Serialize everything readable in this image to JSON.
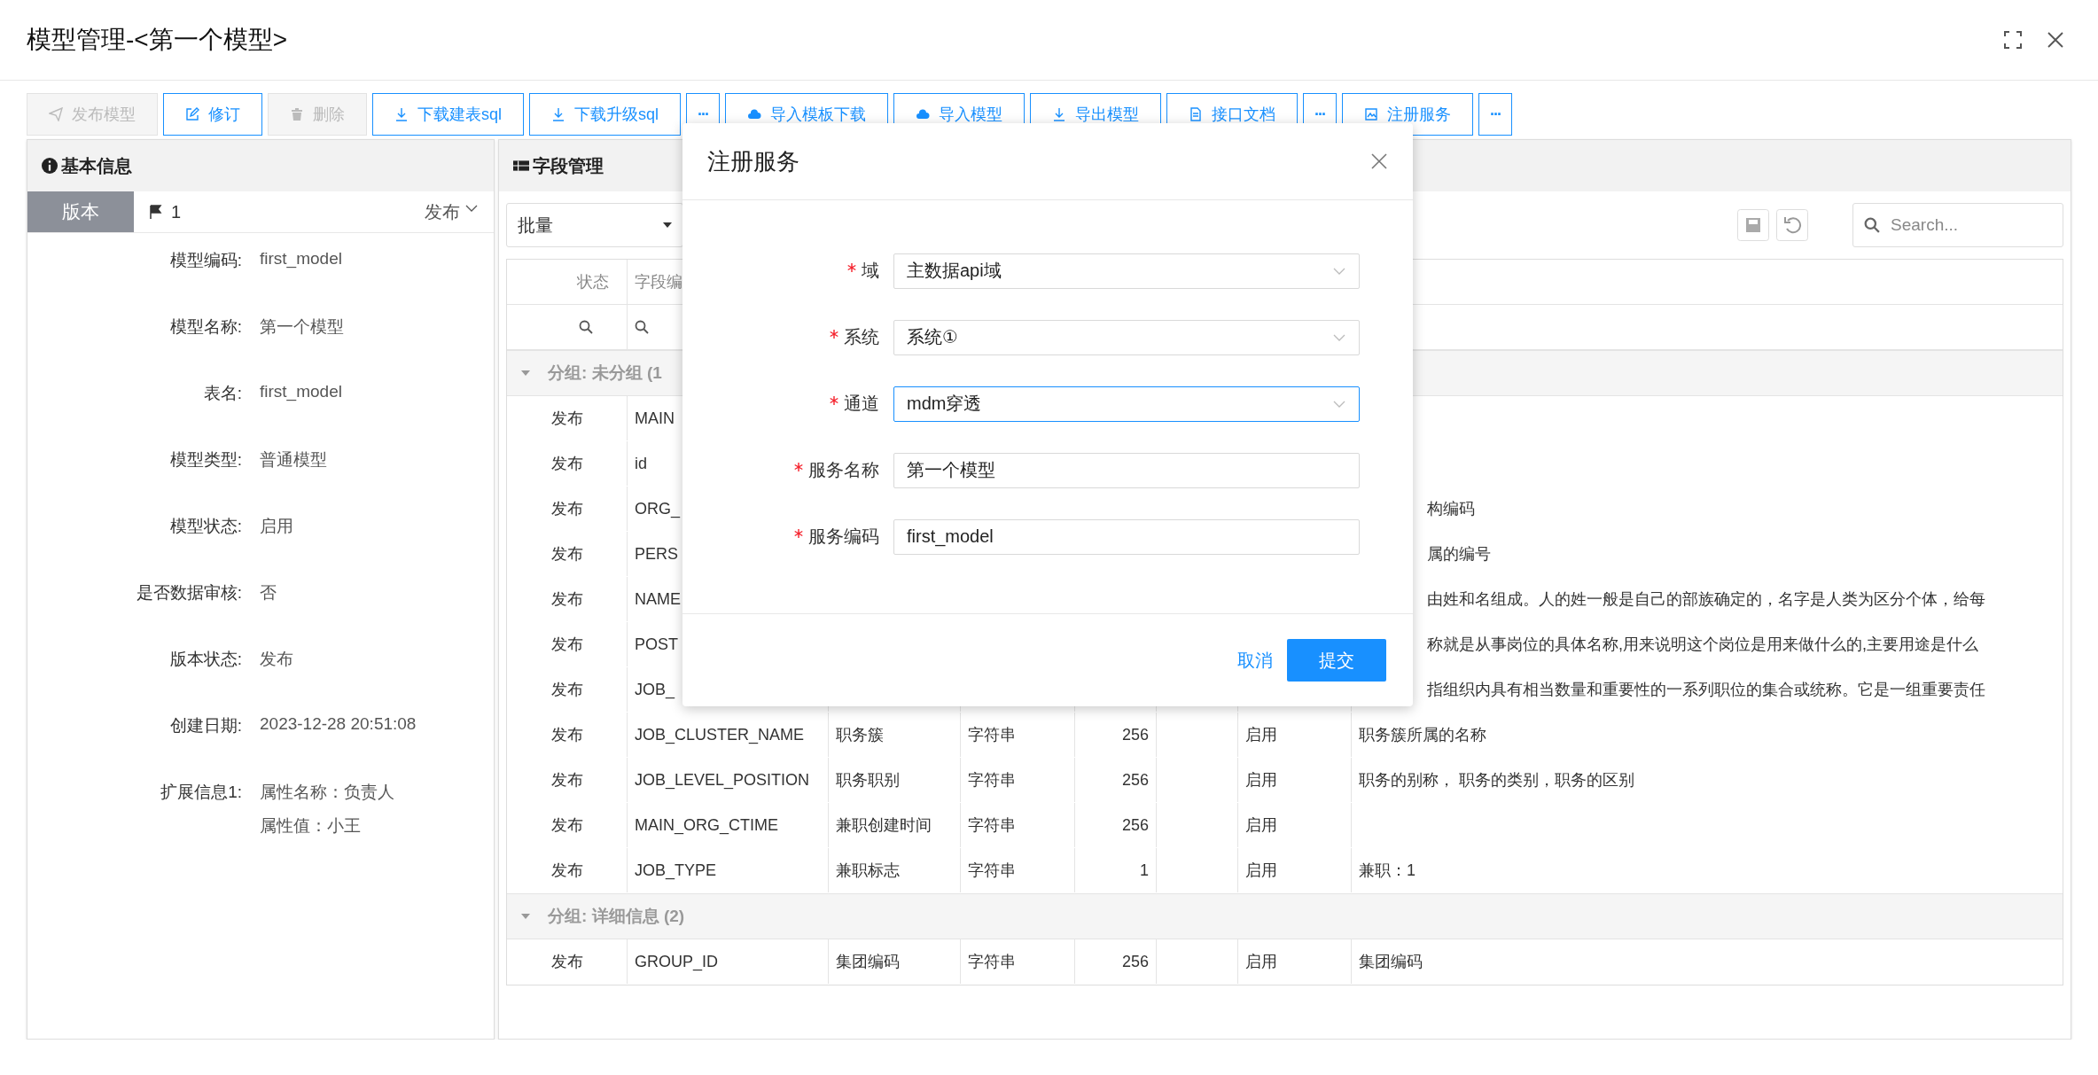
{
  "window": {
    "title": "模型管理-<第一个模型>"
  },
  "toolbar": [
    {
      "label": "发布模型",
      "kind": "send",
      "disabled": true
    },
    {
      "label": "修订",
      "kind": "edit",
      "disabled": false
    },
    {
      "label": "删除",
      "kind": "trash",
      "disabled": true
    },
    {
      "label": "下载建表sql",
      "kind": "download",
      "disabled": false
    },
    {
      "label": "下载升级sql",
      "kind": "download",
      "disabled": false
    },
    {
      "label": "···",
      "kind": "more",
      "disabled": false
    },
    {
      "label": "导入模板下载",
      "kind": "upload",
      "disabled": false
    },
    {
      "label": "导入模型",
      "kind": "upload",
      "disabled": false
    },
    {
      "label": "导出模型",
      "kind": "download",
      "disabled": false
    },
    {
      "label": "接口文档",
      "kind": "doc",
      "disabled": false
    },
    {
      "label": "···",
      "kind": "more",
      "disabled": false
    },
    {
      "label": "注册服务",
      "kind": "register",
      "disabled": false
    },
    {
      "label": "···",
      "kind": "more",
      "disabled": false
    }
  ],
  "basic_info": {
    "title": "基本信息",
    "version_tab": "版本",
    "version": "1",
    "version_status": "发布",
    "fields": [
      {
        "label": "模型编码:",
        "values": [
          "first_model"
        ]
      },
      {
        "label": "模型名称:",
        "values": [
          "第一个模型"
        ]
      },
      {
        "label": "表名:",
        "values": [
          "first_model"
        ]
      },
      {
        "label": "模型类型:",
        "values": [
          "普通模型"
        ]
      },
      {
        "label": "模型状态:",
        "values": [
          "启用"
        ]
      },
      {
        "label": "是否数据审核:",
        "values": [
          "否"
        ]
      },
      {
        "label": "版本状态:",
        "values": [
          "发布"
        ]
      },
      {
        "label": "创建日期:",
        "values": [
          "2023-12-28 20:51:08"
        ]
      },
      {
        "label": "扩展信息1:",
        "values": [
          "属性名称：负责人",
          "属性值：小王"
        ]
      }
    ]
  },
  "fields_panel": {
    "title": "字段管理",
    "batch": "批量",
    "search": {
      "placeholder": "Search..."
    },
    "columns": [
      "状态",
      "字段编"
    ],
    "groups": [
      {
        "label": "分组: 未分组 (1",
        "expanded": true,
        "rows": [
          {
            "status": "发布",
            "code": "MAIN"
          },
          {
            "status": "发布",
            "code": "id"
          },
          {
            "status": "发布",
            "code": "ORG_",
            "description": "构编码"
          },
          {
            "status": "发布",
            "code": "PERS",
            "description": "属的编号"
          },
          {
            "status": "发布",
            "code": "NAME",
            "description": "由姓和名组成。人的姓一般是自己的部族确定的，名字是人类为区分个体，给每"
          },
          {
            "status": "发布",
            "code": "POST",
            "description": "称就是从事岗位的具体名称,用来说明这个岗位是用来做什么的,主要用途是什么"
          },
          {
            "status": "发布",
            "code": "JOB_",
            "description": "指组织内具有相当数量和重要性的一系列职位的集合或统称。它是一组重要责任"
          },
          {
            "status": "发布",
            "code": "JOB_CLUSTER_NAME",
            "name": "职务簇",
            "type": "字符串",
            "length": "256",
            "enabled": "启用",
            "description": "职务簇所属的名称"
          },
          {
            "status": "发布",
            "code": "JOB_LEVEL_POSITION",
            "name": "职务职别",
            "type": "字符串",
            "length": "256",
            "enabled": "启用",
            "description": "职务的别称， 职务的类别，职务的区别"
          },
          {
            "status": "发布",
            "code": "MAIN_ORG_CTIME",
            "name": "兼职创建时间",
            "type": "字符串",
            "length": "256",
            "enabled": "启用"
          },
          {
            "status": "发布",
            "code": "JOB_TYPE",
            "name": "兼职标志",
            "type": "字符串",
            "length": "1",
            "enabled": "启用",
            "description": "兼职：1"
          }
        ]
      },
      {
        "label": "分组: 详细信息 (2)",
        "expanded": true,
        "rows": [
          {
            "status": "发布",
            "code": "GROUP_ID",
            "name": "集团编码",
            "type": "字符串",
            "length": "256",
            "enabled": "启用",
            "description": "集团编码"
          }
        ]
      }
    ]
  },
  "dialog": {
    "title": "注册服务",
    "fields": [
      {
        "label": "域",
        "kind": "select",
        "value": "主数据api域",
        "required": true,
        "focused": false
      },
      {
        "label": "系统",
        "kind": "select",
        "value": "系统①",
        "required": true,
        "focused": false
      },
      {
        "label": "通道",
        "kind": "select",
        "value": "mdm穿透",
        "required": true,
        "focused": true
      },
      {
        "label": "服务名称",
        "kind": "input",
        "value": "第一个模型",
        "required": true,
        "focused": false
      },
      {
        "label": "服务编码",
        "kind": "input",
        "value": "first_model",
        "required": true,
        "focused": false
      }
    ],
    "cancel": "取消",
    "submit": "提交"
  }
}
